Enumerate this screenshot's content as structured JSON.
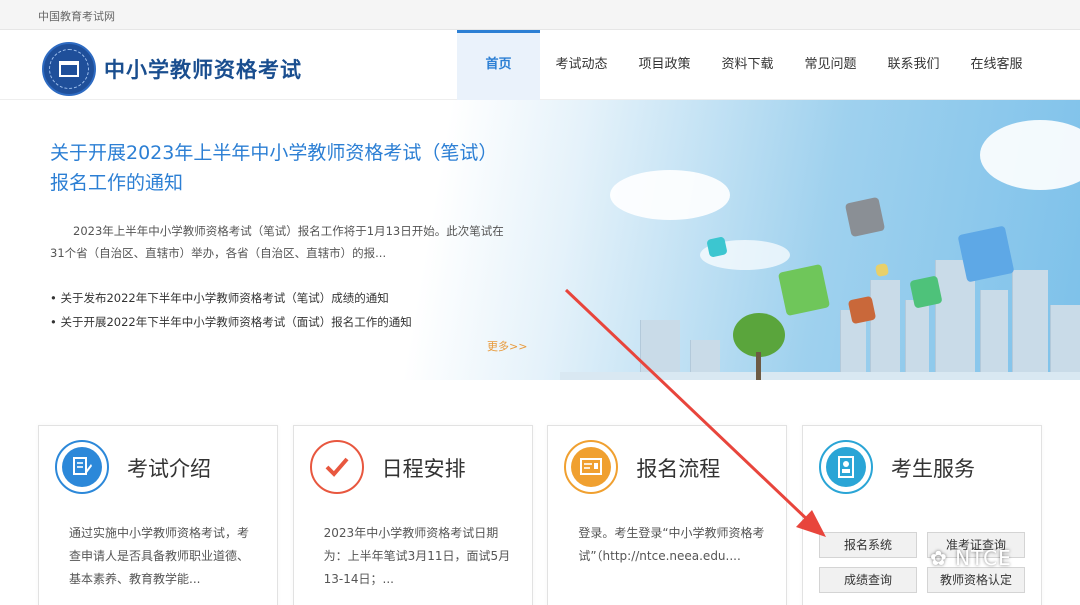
{
  "topbar": {
    "site_name": "中国教育考试网"
  },
  "header": {
    "brand": "中小学教师资格考试",
    "nav": [
      {
        "label": "首页",
        "active": true
      },
      {
        "label": "考试动态"
      },
      {
        "label": "项目政策"
      },
      {
        "label": "资料下载"
      },
      {
        "label": "常见问题"
      },
      {
        "label": "联系我们"
      },
      {
        "label": "在线客服"
      }
    ]
  },
  "banner": {
    "headline": "关于开展2023年上半年中小学教师资格考试（笔试）报名工作的通知",
    "summary": "2023年上半年中小学教师资格考试（笔试）报名工作将于1月13日开始。此次笔试在31个省（自治区、直辖市）举办，各省（自治区、直辖市）的报...",
    "links": [
      "关于发布2022年下半年中小学教师资格考试（笔试）成绩的通知",
      "关于开展2022年下半年中小学教师资格考试（面试）报名工作的通知"
    ],
    "more": "更多>>"
  },
  "cards": [
    {
      "title": "考试介绍",
      "desc": "通过实施中小学教师资格考试，考查申请人是否具备教师职业道德、基本素养、教育教学能...",
      "icon": "document-edit-icon",
      "color": "#2c88d9"
    },
    {
      "title": "日程安排",
      "desc": "2023年中小学教师资格考试日期为：上半年笔试3月11日，面试5月13-14日；...",
      "icon": "checkmark-icon",
      "color": "#e8573f"
    },
    {
      "title": "报名流程",
      "desc": "登录。考生登录“中小学教师资格考试”（http://ntce.neea.edu....",
      "icon": "form-icon",
      "color": "#f0a030"
    },
    {
      "title": "考生服务",
      "icon": "id-card-icon",
      "color": "#2aa5d6",
      "buttons": [
        "报名系统",
        "准考证查询",
        "成绩查询",
        "教师资格认定"
      ]
    }
  ],
  "overlay": {
    "watermark": "NTCE",
    "arrow_color": "#e8453c"
  }
}
